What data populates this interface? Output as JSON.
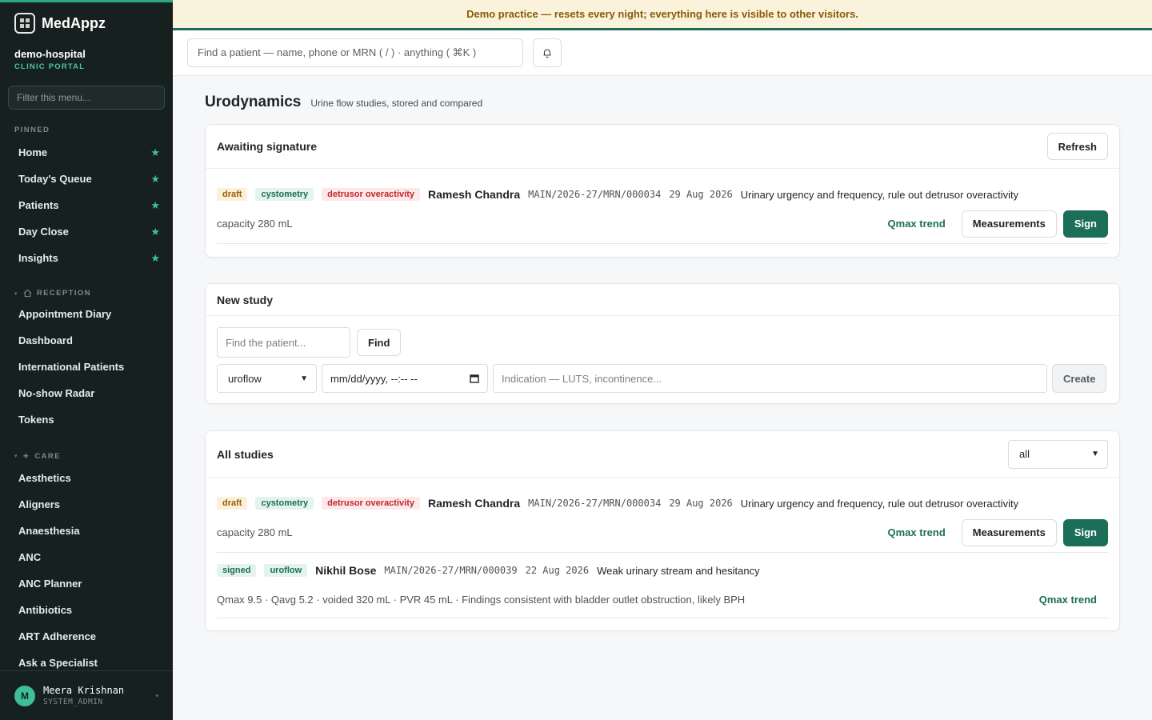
{
  "app": {
    "brand": "MedAppz",
    "org_name": "demo-hospital",
    "org_sub": "CLINIC PORTAL",
    "menu_filter_placeholder": "Filter this menu..."
  },
  "banner": "Demo practice — resets every night; everything here is visible to other visitors.",
  "search_placeholder": "Find a patient — name, phone or MRN ( / ) · anything ( ⌘K )",
  "sidebar": {
    "pinned_title": "PINNED",
    "pinned": [
      "Home",
      "Today's Queue",
      "Patients",
      "Day Close",
      "Insights"
    ],
    "reception_title": "RECEPTION",
    "reception": [
      "Appointment Diary",
      "Dashboard",
      "International Patients",
      "No-show Radar",
      "Tokens"
    ],
    "care_title": "CARE",
    "care": [
      "Aesthetics",
      "Aligners",
      "Anaesthesia",
      "ANC",
      "ANC Planner",
      "Antibiotics",
      "ART Adherence",
      "Ask a Specialist"
    ]
  },
  "user": {
    "initial": "M",
    "name": "Meera Krishnan",
    "role": "SYSTEM_ADMIN"
  },
  "page": {
    "title": "Urodynamics",
    "subtitle": "Urine flow studies, stored and compared"
  },
  "awaiting": {
    "title": "Awaiting signature",
    "refresh_label": "Refresh",
    "study": {
      "status": "draft",
      "type": "cystometry",
      "finding": "detrusor overactivity",
      "patient": "Ramesh Chandra",
      "mrn": "MAIN/2026-27/MRN/000034",
      "date": "29 Aug 2026",
      "indication": "Urinary urgency and frequency, rule out detrusor overactivity",
      "summary": "capacity 280 mL",
      "trend_label": "Qmax trend",
      "measure_label": "Measurements",
      "sign_label": "Sign"
    }
  },
  "new_study": {
    "title": "New study",
    "patient_placeholder": "Find the patient...",
    "find_label": "Find",
    "type_value": "uroflow",
    "datetime_placeholder": "mm/dd/yyyy, --:-- --",
    "indication_placeholder": "Indication — LUTS, incontinence...",
    "create_label": "Create"
  },
  "all_studies": {
    "title": "All studies",
    "filter_value": "all",
    "studies": [
      {
        "status": "draft",
        "type": "cystometry",
        "finding": "detrusor overactivity",
        "patient": "Ramesh Chandra",
        "mrn": "MAIN/2026-27/MRN/000034",
        "date": "29 Aug 2026",
        "indication": "Urinary urgency and frequency, rule out detrusor overactivity",
        "summary": "capacity 280 mL",
        "trend_label": "Qmax trend",
        "measure_label": "Measurements",
        "sign_label": "Sign"
      },
      {
        "status": "signed",
        "type": "uroflow",
        "patient": "Nikhil Bose",
        "mrn": "MAIN/2026-27/MRN/000039",
        "date": "22 Aug 2026",
        "indication": "Weak urinary stream and hesitancy",
        "summary": "Qmax 9.5 · Qavg 5.2 · voided 320 mL · PVR 45 mL · Findings consistent with bladder outlet obstruction, likely BPH",
        "trend_label": "Qmax trend"
      }
    ]
  },
  "colors": {
    "accent": "#1b6e57",
    "sidebar_bg": "#15201f",
    "banner_bg": "#fbf2dc",
    "star": "#3fbf97"
  }
}
